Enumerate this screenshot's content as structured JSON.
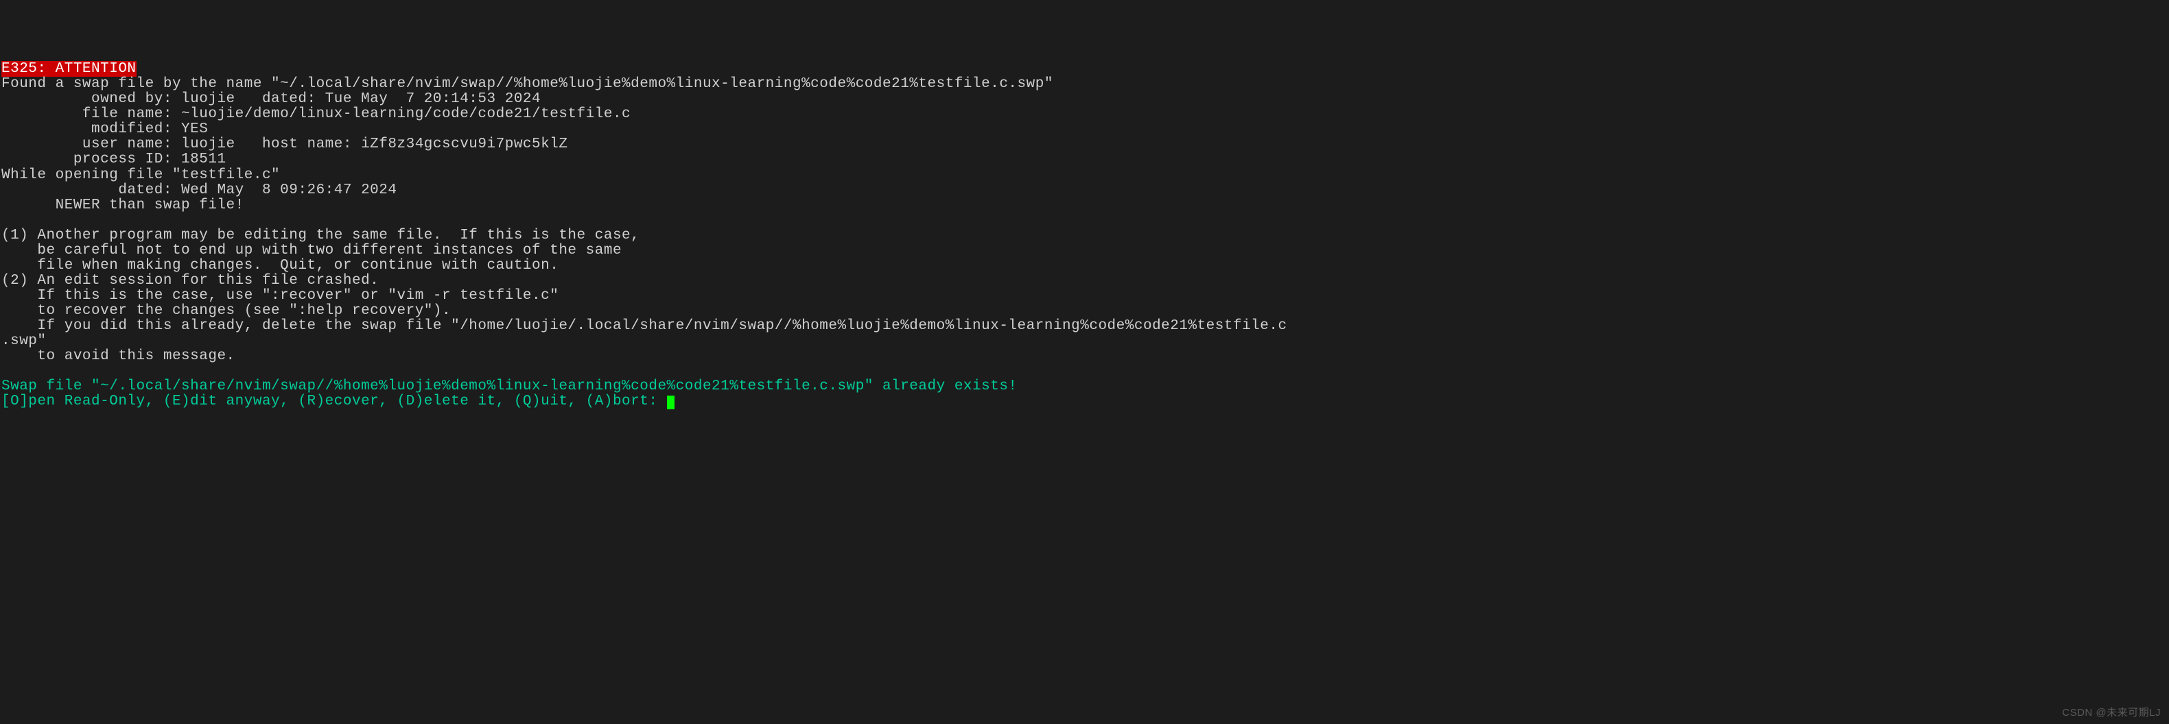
{
  "error_code": "E325: ATTENTION",
  "found_swap_line": "Found a swap file by the name \"~/.local/share/nvim/swap//%home%luojie%demo%linux-learning%code%code21%testfile.c.swp\"",
  "owned_by_line": "          owned by: luojie   dated: Tue May  7 20:14:53 2024",
  "file_name_line": "         file name: ~luojie/demo/linux-learning/code/code21/testfile.c",
  "modified_line": "          modified: YES",
  "user_host_line": "         user name: luojie   host name: iZf8z34gcscvu9i7pwc5klZ",
  "process_id_line": "        process ID: 18511",
  "while_opening_line": "While opening file \"testfile.c\"",
  "dated_line": "             dated: Wed May  8 09:26:47 2024",
  "newer_line": "      NEWER than swap file!",
  "blank": "",
  "warning1_line1": "(1) Another program may be editing the same file.  If this is the case,",
  "warning1_line2": "    be careful not to end up with two different instances of the same",
  "warning1_line3": "    file when making changes.  Quit, or continue with caution.",
  "warning2_line1": "(2) An edit session for this file crashed.",
  "warning2_line2": "    If this is the case, use \":recover\" or \"vim -r testfile.c\"",
  "warning2_line3": "    to recover the changes (see \":help recovery\").",
  "warning2_line4": "    If you did this already, delete the swap file \"/home/luojie/.local/share/nvim/swap//%home%luojie%demo%linux-learning%code%code21%testfile.c",
  "warning2_line5": ".swp\"",
  "warning2_line6": "    to avoid this message.",
  "swap_exists_line": "Swap file \"~/.local/share/nvim/swap//%home%luojie%demo%linux-learning%code%code21%testfile.c.swp\" already exists!",
  "prompt_line": "[O]pen Read-Only, (E)dit anyway, (R)ecover, (D)elete it, (Q)uit, (A)bort: ",
  "watermark": "CSDN @未来可期LJ"
}
